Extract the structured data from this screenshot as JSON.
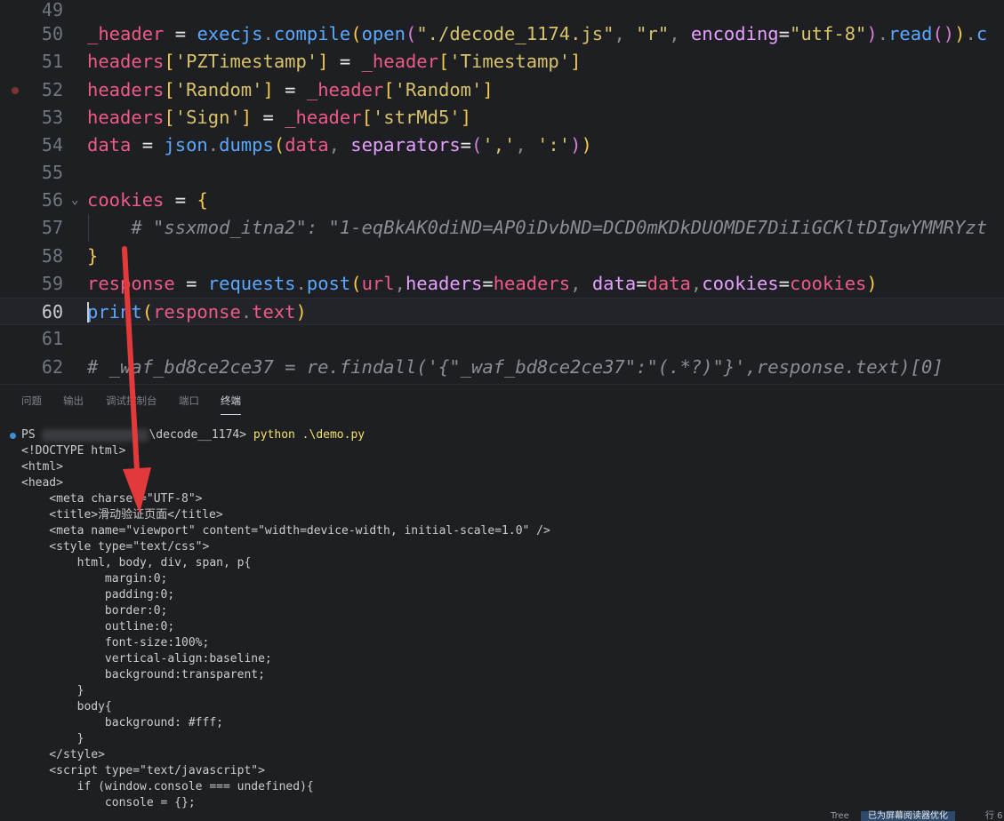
{
  "editor": {
    "lines": [
      {
        "num": "49",
        "tokens": []
      },
      {
        "num": "50",
        "tokens": [
          {
            "c": "t-var",
            "t": "_header"
          },
          {
            "c": "t-op",
            "t": " = "
          },
          {
            "c": "t-fn",
            "t": "execjs"
          },
          {
            "c": "t-dot",
            "t": "."
          },
          {
            "c": "t-fn",
            "t": "compile"
          },
          {
            "c": "t-paren",
            "t": "("
          },
          {
            "c": "t-fn",
            "t": "open"
          },
          {
            "c": "t-paren2",
            "t": "("
          },
          {
            "c": "t-str",
            "t": "\"./decode_1174.js\""
          },
          {
            "c": "t-dot",
            "t": ", "
          },
          {
            "c": "t-str",
            "t": "\"r\""
          },
          {
            "c": "t-dot",
            "t": ", "
          },
          {
            "c": "t-param",
            "t": "encoding"
          },
          {
            "c": "t-op",
            "t": "="
          },
          {
            "c": "t-str",
            "t": "\"utf-8\""
          },
          {
            "c": "t-paren2",
            "t": ")"
          },
          {
            "c": "t-dot",
            "t": "."
          },
          {
            "c": "t-fn",
            "t": "read"
          },
          {
            "c": "t-paren2",
            "t": "()"
          },
          {
            "c": "t-paren",
            "t": ")"
          },
          {
            "c": "t-dot",
            "t": "."
          },
          {
            "c": "t-fn",
            "t": "c"
          }
        ]
      },
      {
        "num": "51",
        "tokens": [
          {
            "c": "t-var",
            "t": "headers"
          },
          {
            "c": "t-paren",
            "t": "["
          },
          {
            "c": "t-str",
            "t": "'PZTimestamp'"
          },
          {
            "c": "t-paren",
            "t": "]"
          },
          {
            "c": "t-op",
            "t": " = "
          },
          {
            "c": "t-var",
            "t": "_header"
          },
          {
            "c": "t-paren",
            "t": "["
          },
          {
            "c": "t-str",
            "t": "'Timestamp'"
          },
          {
            "c": "t-paren",
            "t": "]"
          }
        ]
      },
      {
        "num": "52",
        "tokens": [
          {
            "c": "t-var",
            "t": "headers"
          },
          {
            "c": "t-paren",
            "t": "["
          },
          {
            "c": "t-str",
            "t": "'Random'"
          },
          {
            "c": "t-paren",
            "t": "]"
          },
          {
            "c": "t-op",
            "t": " = "
          },
          {
            "c": "t-var",
            "t": "_header"
          },
          {
            "c": "t-paren",
            "t": "["
          },
          {
            "c": "t-str",
            "t": "'Random'"
          },
          {
            "c": "t-paren",
            "t": "]"
          }
        ]
      },
      {
        "num": "53",
        "tokens": [
          {
            "c": "t-var",
            "t": "headers"
          },
          {
            "c": "t-paren",
            "t": "["
          },
          {
            "c": "t-str",
            "t": "'Sign'"
          },
          {
            "c": "t-paren",
            "t": "]"
          },
          {
            "c": "t-op",
            "t": " = "
          },
          {
            "c": "t-var",
            "t": "_header"
          },
          {
            "c": "t-paren",
            "t": "["
          },
          {
            "c": "t-str",
            "t": "'strMd5'"
          },
          {
            "c": "t-paren",
            "t": "]"
          }
        ]
      },
      {
        "num": "54",
        "tokens": [
          {
            "c": "t-var",
            "t": "data"
          },
          {
            "c": "t-op",
            "t": " = "
          },
          {
            "c": "t-fn",
            "t": "json"
          },
          {
            "c": "t-dot",
            "t": "."
          },
          {
            "c": "t-fn",
            "t": "dumps"
          },
          {
            "c": "t-paren",
            "t": "("
          },
          {
            "c": "t-var",
            "t": "data"
          },
          {
            "c": "t-dot",
            "t": ", "
          },
          {
            "c": "t-param",
            "t": "separators"
          },
          {
            "c": "t-op",
            "t": "="
          },
          {
            "c": "t-paren2",
            "t": "("
          },
          {
            "c": "t-str",
            "t": "','"
          },
          {
            "c": "t-dot",
            "t": ", "
          },
          {
            "c": "t-str",
            "t": "':'"
          },
          {
            "c": "t-paren2",
            "t": ")"
          },
          {
            "c": "t-paren",
            "t": ")"
          }
        ]
      },
      {
        "num": "55",
        "tokens": []
      },
      {
        "num": "56",
        "fold": "⌄",
        "tokens": [
          {
            "c": "t-var",
            "t": "cookies"
          },
          {
            "c": "t-op",
            "t": " = "
          },
          {
            "c": "t-paren",
            "t": "{"
          }
        ]
      },
      {
        "num": "57",
        "guide": true,
        "tokens": [
          {
            "c": "t-comment",
            "t": "    # \"ssxmod_itna2\": \"1-eqBkAK0diND=AP0iDvbND=DCD0mKDkDUOMDE7DiIiGCKltDIgwYMMRYzt"
          }
        ]
      },
      {
        "num": "58",
        "tokens": [
          {
            "c": "t-paren",
            "t": "}"
          }
        ]
      },
      {
        "num": "59",
        "tokens": [
          {
            "c": "t-var",
            "t": "response"
          },
          {
            "c": "t-op",
            "t": " = "
          },
          {
            "c": "t-fn",
            "t": "requests"
          },
          {
            "c": "t-dot",
            "t": "."
          },
          {
            "c": "t-fn",
            "t": "post"
          },
          {
            "c": "t-paren",
            "t": "("
          },
          {
            "c": "t-var",
            "t": "url"
          },
          {
            "c": "t-dot",
            "t": ","
          },
          {
            "c": "t-param",
            "t": "headers"
          },
          {
            "c": "t-op",
            "t": "="
          },
          {
            "c": "t-var",
            "t": "headers"
          },
          {
            "c": "t-dot",
            "t": ", "
          },
          {
            "c": "t-param",
            "t": "data"
          },
          {
            "c": "t-op",
            "t": "="
          },
          {
            "c": "t-var",
            "t": "data"
          },
          {
            "c": "t-dot",
            "t": ","
          },
          {
            "c": "t-param",
            "t": "cookies"
          },
          {
            "c": "t-op",
            "t": "="
          },
          {
            "c": "t-var",
            "t": "cookies"
          },
          {
            "c": "t-paren",
            "t": ")"
          }
        ]
      },
      {
        "num": "60",
        "active": true,
        "tokens": [
          {
            "c": "t-fn",
            "t": "print"
          },
          {
            "c": "t-paren",
            "t": "("
          },
          {
            "c": "t-var",
            "t": "response"
          },
          {
            "c": "t-dot",
            "t": "."
          },
          {
            "c": "t-var",
            "t": "text"
          },
          {
            "c": "t-paren",
            "t": ")"
          }
        ]
      },
      {
        "num": "61",
        "tokens": []
      },
      {
        "num": "62",
        "tokens": [
          {
            "c": "t-comment",
            "t": "# _waf_bd8ce2ce37 = re.findall('{\"_waf_bd8ce2ce37\":\"(.*?)\"}',response.text)[0]"
          }
        ]
      }
    ]
  },
  "panel": {
    "tabs": [
      {
        "label": "问题",
        "active": false
      },
      {
        "label": "输出",
        "active": false
      },
      {
        "label": "调试控制台",
        "active": false
      },
      {
        "label": "端口",
        "active": false
      },
      {
        "label": "终端",
        "active": true
      }
    ],
    "terminal": {
      "prompt_prefix": "PS ",
      "prompt_path_suffix": "\\decode__1174> ",
      "command": "python .\\demo.py",
      "output": [
        "<!DOCTYPE html>",
        "<html>",
        "<head>",
        "    <meta charset=\"UTF-8\">",
        "    <title>滑动验证页面</title>",
        "    <meta name=\"viewport\" content=\"width=device-width, initial-scale=1.0\" />",
        "    <style type=\"text/css\">",
        "        html, body, div, span, p{",
        "            margin:0;",
        "            padding:0;",
        "            border:0;",
        "            outline:0;",
        "            font-size:100%;",
        "            vertical-align:baseline;",
        "            background:transparent;",
        "        }",
        "        body{",
        "            background: #fff;",
        "        }",
        "    </style>",
        "    <script type=\"text/javascript\">",
        "        if (window.console === undefined){",
        "            console = {};"
      ]
    }
  },
  "statusbar": {
    "items": [
      {
        "label": "Tree",
        "highlight": false
      },
      {
        "label": "已为屏幕阅读器优化",
        "highlight": true
      },
      {
        "label": "行 6",
        "highlight": false
      }
    ]
  },
  "colors": {
    "arrow": "#e23a3a",
    "background": "#1e1f22"
  }
}
